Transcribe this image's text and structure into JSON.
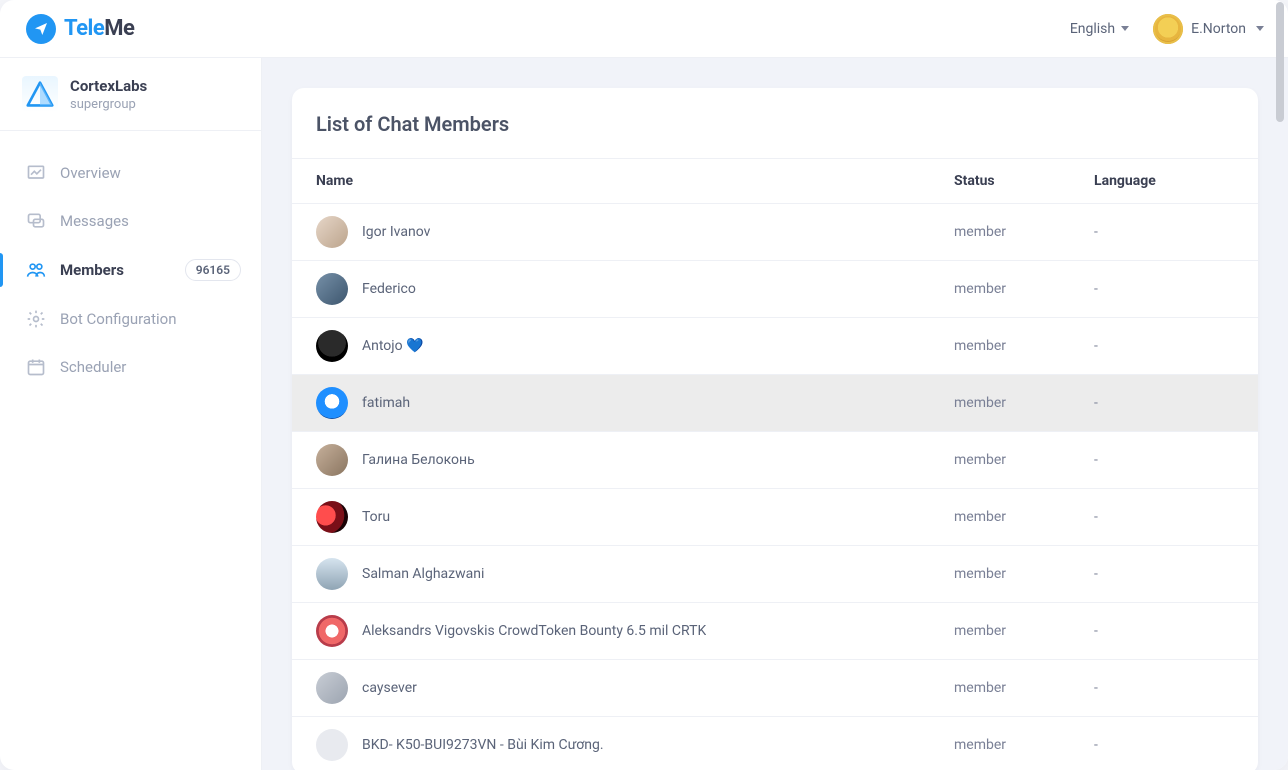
{
  "brand": {
    "tele": "Tele",
    "me": "Me"
  },
  "top": {
    "language_label": "English",
    "user_name": "E.Norton"
  },
  "group": {
    "name": "CortexLabs",
    "subtitle": "supergroup"
  },
  "nav": {
    "overview": "Overview",
    "messages": "Messages",
    "members": "Members",
    "members_badge": "96165",
    "bot_config": "Bot Configuration",
    "scheduler": "Scheduler"
  },
  "page": {
    "title": "List of Chat Members",
    "columns": {
      "name": "Name",
      "status": "Status",
      "language": "Language"
    }
  },
  "rows": [
    {
      "name": "Igor Ivanov",
      "status": "member",
      "language": "-",
      "av": "av1"
    },
    {
      "name": "Federico",
      "status": "member",
      "language": "-",
      "av": "av2"
    },
    {
      "name": "Antojo 💙",
      "status": "member",
      "language": "-",
      "av": "av3"
    },
    {
      "name": "fatimah",
      "status": "member",
      "language": "-",
      "av": "av4",
      "hovered": true
    },
    {
      "name": "Галина Белоконь",
      "status": "member",
      "language": "-",
      "av": "av5"
    },
    {
      "name": "Toru",
      "status": "member",
      "language": "-",
      "av": "av6"
    },
    {
      "name": "Salman Alghazwani",
      "status": "member",
      "language": "-",
      "av": "av7"
    },
    {
      "name": "Aleksandrs Vigovskis CrowdToken Bounty 6.5 mil CRTK",
      "status": "member",
      "language": "-",
      "av": "av8"
    },
    {
      "name": "caysever",
      "status": "member",
      "language": "-",
      "av": "av9"
    },
    {
      "name": "BKD- K50-BUI9273VN - Bùi Kim Cương.",
      "status": "member",
      "language": "-",
      "av": "av10"
    }
  ]
}
